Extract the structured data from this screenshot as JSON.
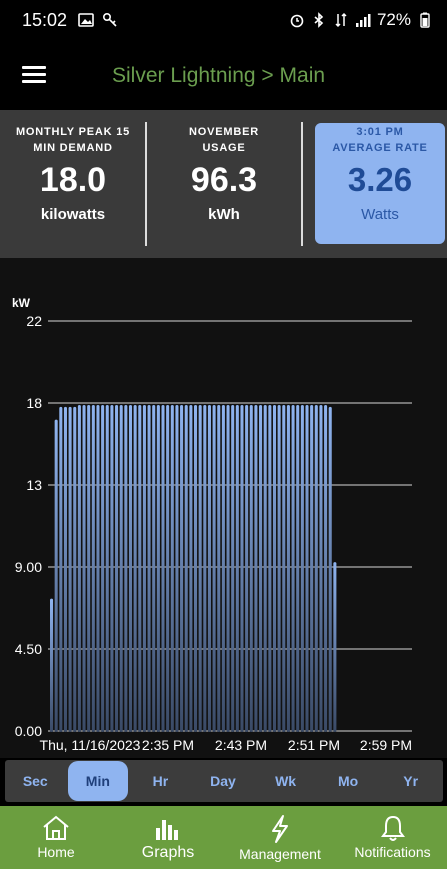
{
  "status_bar": {
    "time": "15:02",
    "battery": "72%",
    "left_icons": [
      "image-icon",
      "key-icon"
    ],
    "right_icons": [
      "alarm-icon",
      "bluetooth-icon",
      "data-icon",
      "signal-icon",
      "battery-icon"
    ]
  },
  "app_bar": {
    "title": "Silver Lightning > Main"
  },
  "stats": {
    "peak": {
      "heading_line1": "MONTHLY PEAK 15",
      "heading_line2": "MIN DEMAND",
      "value": "18.0",
      "unit": "kilowatts"
    },
    "usage": {
      "heading_line1": "NOVEMBER",
      "heading_line2": "USAGE",
      "value": "96.3",
      "unit": "kWh"
    },
    "rate": {
      "heading_line1": "3:01 PM",
      "heading_line2": "AVERAGE RATE",
      "value": "3.26",
      "unit": "Watts"
    }
  },
  "chart_data": {
    "type": "bar",
    "ylabel": "kW",
    "y_ticks": [
      "22",
      "18",
      "13",
      "9.00",
      "4.50",
      "0.00"
    ],
    "ylim": [
      0,
      22.5
    ],
    "grid": true,
    "x_tick_labels": [
      "Thu, 11/16/2023",
      "2:35 PM",
      "2:43 PM",
      "2:51 PM",
      "2:59 PM"
    ],
    "values": [
      7.3,
      17.1,
      17.8,
      17.8,
      17.8,
      17.8,
      17.9,
      17.9,
      17.9,
      17.9,
      17.9,
      17.9,
      17.9,
      17.9,
      17.9,
      17.9,
      17.9,
      17.9,
      17.9,
      17.9,
      17.9,
      17.9,
      17.9,
      17.9,
      17.9,
      17.9,
      17.9,
      17.9,
      17.9,
      17.9,
      17.9,
      17.9,
      17.9,
      17.9,
      17.9,
      17.9,
      17.9,
      17.9,
      17.9,
      17.9,
      17.9,
      17.9,
      17.9,
      17.9,
      17.9,
      17.9,
      17.9,
      17.9,
      17.9,
      17.9,
      17.9,
      17.9,
      17.9,
      17.9,
      17.9,
      17.9,
      17.9,
      17.9,
      17.9,
      17.9,
      17.8,
      9.3
    ],
    "bar_color": "#8fb4f0"
  },
  "periods": {
    "items": [
      "Sec",
      "Min",
      "Hr",
      "Day",
      "Wk",
      "Mo",
      "Yr"
    ],
    "active": "Min"
  },
  "bottom_nav": {
    "items": [
      {
        "label": "Home",
        "icon": "home-icon"
      },
      {
        "label": "Graphs",
        "icon": "bar-chart-icon"
      },
      {
        "label": "Management",
        "icon": "lightning-icon"
      },
      {
        "label": "Notifications",
        "icon": "bell-icon"
      }
    ],
    "active": "Graphs"
  },
  "colors": {
    "accent_green": "#6b9e3f",
    "title_green": "#6b9e4f",
    "accent_blue": "#8fb4f0"
  }
}
